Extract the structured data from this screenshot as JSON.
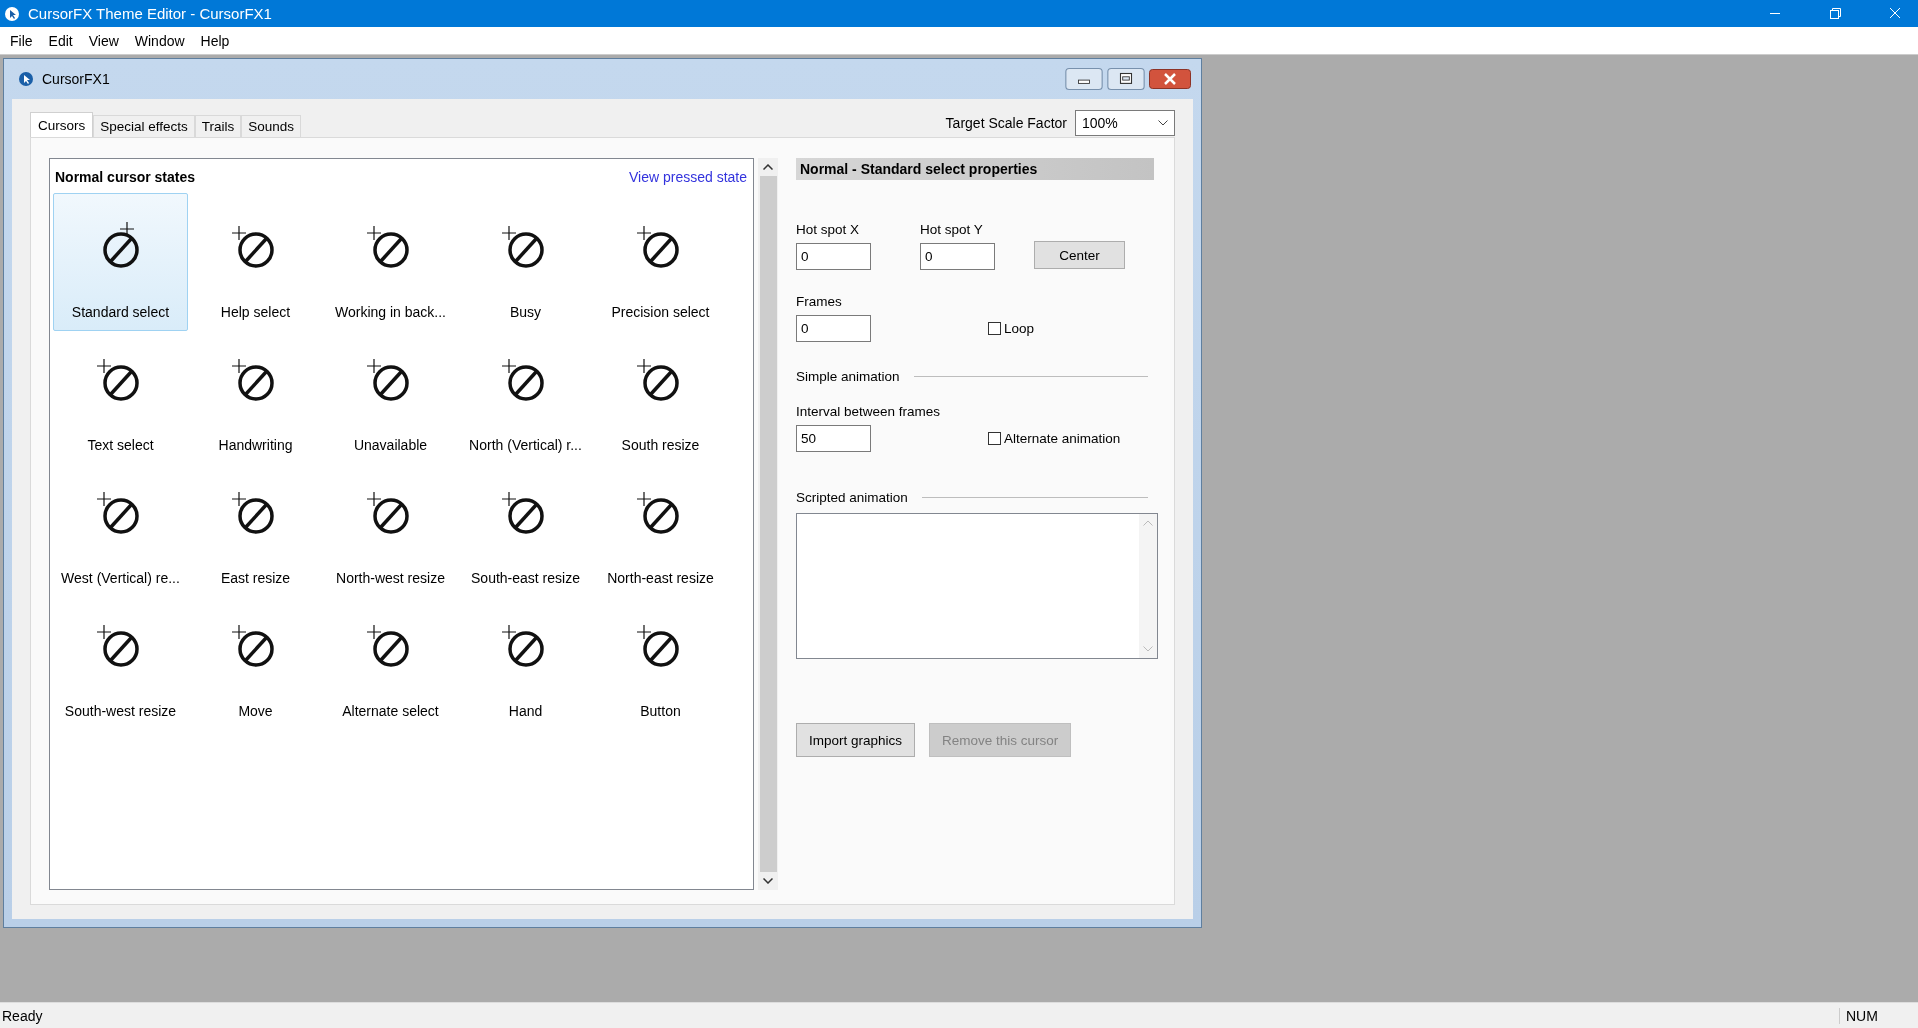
{
  "window": {
    "title": "CursorFX Theme Editor - CursorFX1"
  },
  "menu": [
    {
      "label": "File"
    },
    {
      "label": "Edit"
    },
    {
      "label": "View"
    },
    {
      "label": "Window"
    },
    {
      "label": "Help"
    }
  ],
  "document": {
    "title": "CursorFX1",
    "tabs": [
      {
        "label": "Cursors",
        "selected": true
      },
      {
        "label": "Special effects",
        "selected": false
      },
      {
        "label": "Trails",
        "selected": false
      },
      {
        "label": "Sounds",
        "selected": false
      }
    ],
    "scale_factor": {
      "label": "Target Scale Factor",
      "value": "100%"
    },
    "cursor_list": {
      "heading": "Normal cursor states",
      "link": "View pressed state",
      "items": [
        {
          "label": "Standard select",
          "selected": true
        },
        {
          "label": "Help select",
          "selected": false
        },
        {
          "label": "Working in back...",
          "selected": false
        },
        {
          "label": "Busy",
          "selected": false
        },
        {
          "label": "Precision select",
          "selected": false
        },
        {
          "label": "Text select",
          "selected": false
        },
        {
          "label": "Handwriting",
          "selected": false
        },
        {
          "label": "Unavailable",
          "selected": false
        },
        {
          "label": "North (Vertical) r...",
          "selected": false
        },
        {
          "label": "South resize",
          "selected": false
        },
        {
          "label": "West (Vertical) re...",
          "selected": false
        },
        {
          "label": "East resize",
          "selected": false
        },
        {
          "label": "North-west resize",
          "selected": false
        },
        {
          "label": "South-east resize",
          "selected": false
        },
        {
          "label": "North-east resize",
          "selected": false
        },
        {
          "label": "South-west resize",
          "selected": false
        },
        {
          "label": "Move",
          "selected": false
        },
        {
          "label": "Alternate select",
          "selected": false
        },
        {
          "label": "Hand",
          "selected": false
        },
        {
          "label": "Button",
          "selected": false
        }
      ]
    },
    "properties": {
      "heading": "Normal - Standard select properties",
      "hotspot_x": {
        "label": "Hot spot X",
        "value": "0"
      },
      "hotspot_y": {
        "label": "Hot spot Y",
        "value": "0"
      },
      "center_button": "Center",
      "frames": {
        "label": "Frames",
        "value": "0"
      },
      "loop": {
        "label": "Loop",
        "checked": false
      },
      "simple_animation": "Simple animation",
      "interval": {
        "label": "Interval between frames",
        "value": "50"
      },
      "alternate": {
        "label": "Alternate animation",
        "checked": false
      },
      "scripted_animation": "Scripted animation",
      "buttons": [
        {
          "label": "Import graphics",
          "disabled": false
        },
        {
          "label": "Remove this cursor",
          "disabled": true
        }
      ]
    }
  },
  "status_bar": {
    "text": "Ready",
    "indicator": "NUM"
  }
}
